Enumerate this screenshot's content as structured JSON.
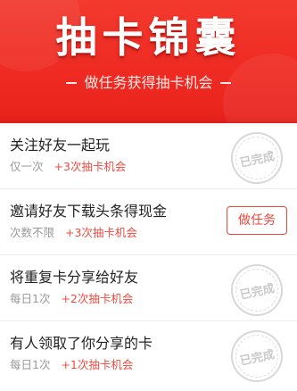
{
  "banner": {
    "title": "抽卡锦囊",
    "subtitle": "做任务获得抽卡机会"
  },
  "tasks": [
    {
      "title": "关注好友一起玩",
      "frequency": "仅一次",
      "reward": "+3次抽卡机会",
      "status": "已完成"
    },
    {
      "title": "邀请好友下载头条得现金",
      "frequency": "次数不限",
      "reward": "+3次抽卡机会",
      "action_label": "做任务"
    },
    {
      "title": "将重复卡分享给好友",
      "frequency": "每日1次",
      "reward": "+2次抽卡机会",
      "status": "已完成"
    },
    {
      "title": "有人领取了你分享的卡",
      "frequency": "每日1次",
      "reward": "+1次抽卡机会",
      "status": "已完成"
    }
  ],
  "colors": {
    "banner_red": "#ef2b23",
    "reward_red": "#f04a40",
    "stamp_gray": "#c9c9c9"
  }
}
